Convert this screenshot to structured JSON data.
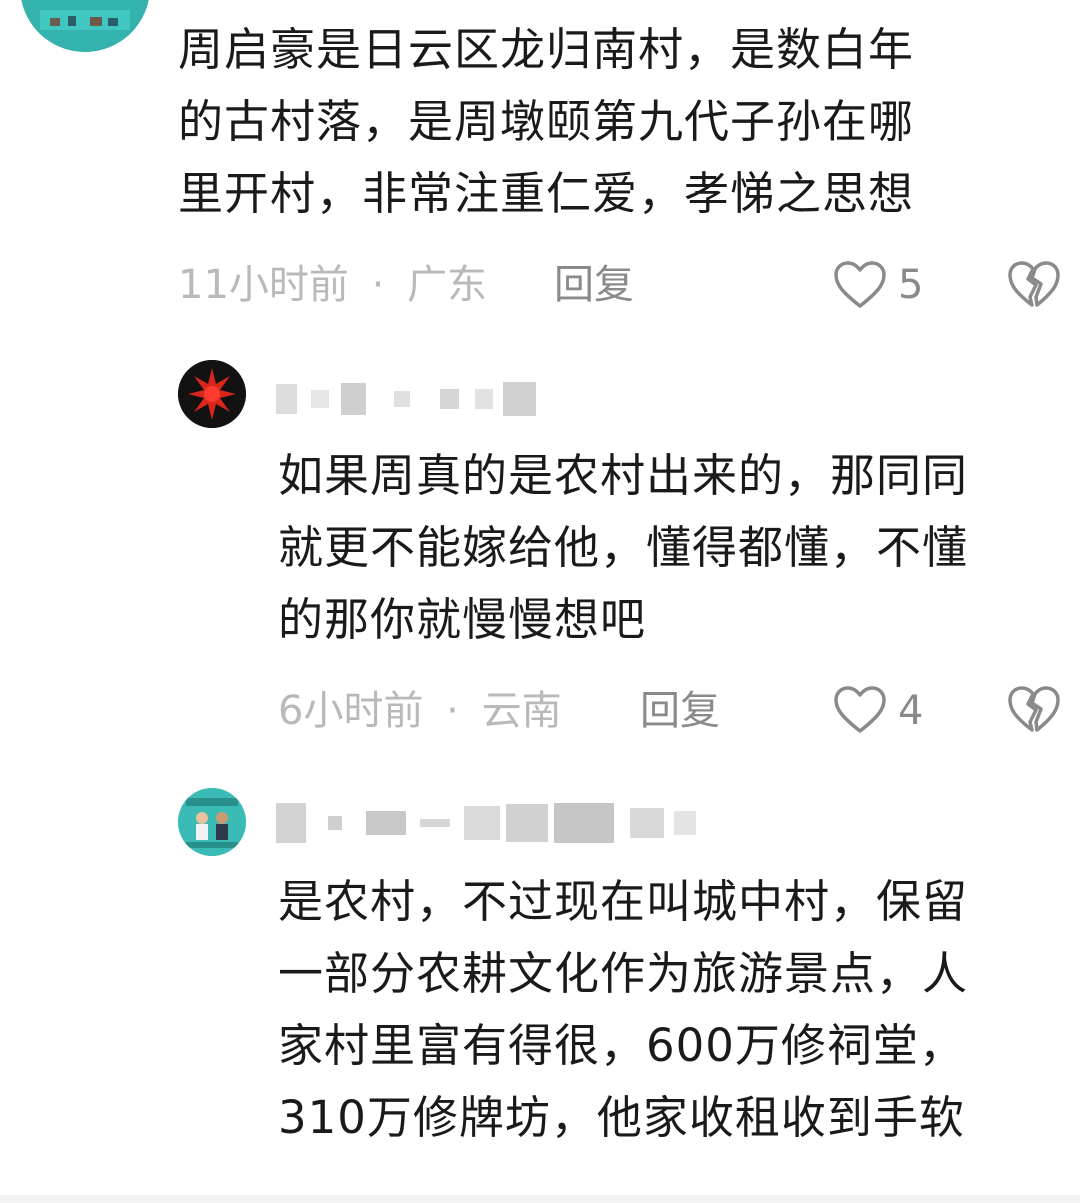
{
  "comments": [
    {
      "text_lines": [
        "周启豪是日云区龙归南村，是数白年",
        "的古村落，是周墩颐第九代子孙在哪",
        "里开村，非常注重仁爱，孝悌之思想"
      ],
      "time": "11小时前",
      "location": "广东",
      "reply_label": "回复",
      "likes": "5"
    },
    {
      "text_lines": [
        "如果周真的是农村出来的，那同同",
        "就更不能嫁给他，懂得都懂，不懂",
        "的那你就慢慢想吧"
      ],
      "time": "6小时前",
      "location": "云南",
      "reply_label": "回复",
      "likes": "4"
    },
    {
      "text_lines": [
        "是农村，不过现在叫城中村，保留",
        "一部分农耕文化作为旅游景点，人",
        "家村里富有得很，600万修祠堂，",
        "310万修牌坊，他家收租收到手软"
      ]
    }
  ],
  "separator": "·",
  "icons": {
    "like": "heart-outline-icon",
    "dislike": "broken-heart-icon"
  },
  "colors": {
    "text": "#1a1a1a",
    "meta": "#b9b9b9",
    "action": "#8a8a8a",
    "avatar_teal": "#35b5b0"
  }
}
